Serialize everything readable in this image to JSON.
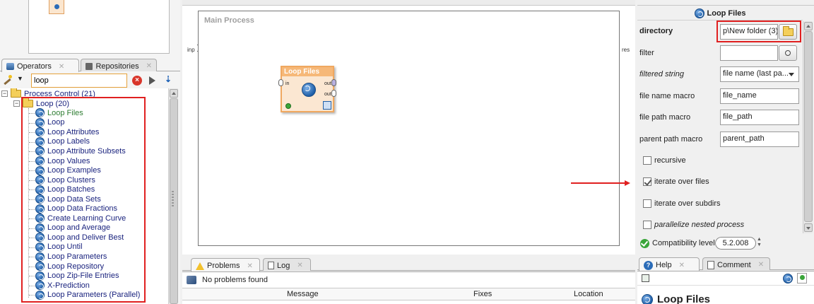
{
  "left_panel": {
    "tabs": [
      {
        "label": "Operators",
        "active": true
      },
      {
        "label": "Repositories",
        "active": false
      }
    ],
    "search": {
      "value": "loop"
    },
    "tree": {
      "root": {
        "label": "Process Control (21)"
      },
      "group": {
        "label": "Loop (20)"
      },
      "items": [
        "Loop Files",
        "Loop",
        "Loop Attributes",
        "Loop Labels",
        "Loop Attribute Subsets",
        "Loop Values",
        "Loop Examples",
        "Loop Clusters",
        "Loop Batches",
        "Loop Data Sets",
        "Loop Data Fractions",
        "Create Learning Curve",
        "Loop and Average",
        "Loop and Deliver Best",
        "Loop Until",
        "Loop Parameters",
        "Loop Repository",
        "Loop Zip-File Entries",
        "X-Prediction",
        "Loop Parameters (Parallel)"
      ]
    }
  },
  "process": {
    "title": "Main Process",
    "left_port": "inp",
    "right_port": "res",
    "operator": {
      "title": "Loop Files",
      "in_port": "in",
      "out_ports": [
        "out",
        "out"
      ]
    }
  },
  "problems": {
    "tabs": [
      {
        "label": "Problems",
        "active": true
      },
      {
        "label": "Log",
        "active": false
      }
    ],
    "status": "No problems found",
    "columns": [
      "Message",
      "Fixes",
      "Location"
    ]
  },
  "parameters": {
    "operator_name": "Loop Files",
    "directory": {
      "label": "directory",
      "value": "p\\New folder (3)"
    },
    "filter": {
      "label": "filter",
      "value": ""
    },
    "filtered_string": {
      "label": "filtered string",
      "value": "file name (last pa..."
    },
    "file_name_macro": {
      "label": "file name macro",
      "value": "file_name"
    },
    "file_path_macro": {
      "label": "file path macro",
      "value": "file_path"
    },
    "parent_path_macro": {
      "label": "parent path macro",
      "value": "parent_path"
    },
    "recursive": {
      "label": "recursive",
      "checked": false
    },
    "iterate_over_files": {
      "label": "iterate over files",
      "checked": true
    },
    "iterate_over_subdirs": {
      "label": "iterate over subdirs",
      "checked": false
    },
    "parallelize": {
      "label": "parallelize nested process",
      "checked": false
    },
    "compatibility": {
      "label": "Compatibility level",
      "value": "5.2.008"
    }
  },
  "help_panel": {
    "tabs": [
      {
        "label": "Help",
        "active": true
      },
      {
        "label": "Comment",
        "active": false
      }
    ],
    "title": "Loop Files"
  },
  "annotation_color": "#e02020"
}
